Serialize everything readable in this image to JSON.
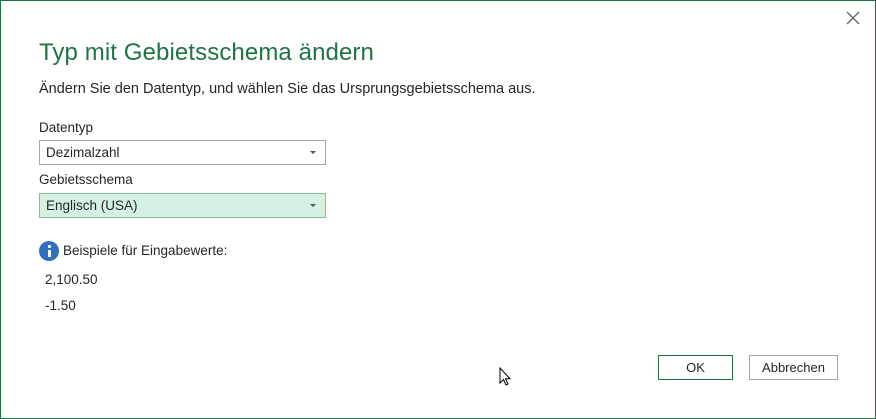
{
  "dialog": {
    "title": "Typ mit Gebietsschema ändern",
    "subtitle": "Ändern Sie den Datentyp, und wählen Sie das Ursprungsgebietsschema aus.",
    "close_icon": "close-icon"
  },
  "fields": {
    "datatype": {
      "label": "Datentyp",
      "value": "Dezimalzahl"
    },
    "locale": {
      "label": "Gebietsschema",
      "value": "Englisch (USA)"
    }
  },
  "info": {
    "icon": "info-icon",
    "text": "Beispiele für Eingabewerte:",
    "examples": [
      "2,100.50",
      "-1.50"
    ]
  },
  "buttons": {
    "ok": "OK",
    "cancel": "Abbrechen"
  },
  "colors": {
    "accent": "#217346",
    "selected_field_bg": "#d3f0e0",
    "info_icon": "#2f6fbf"
  }
}
